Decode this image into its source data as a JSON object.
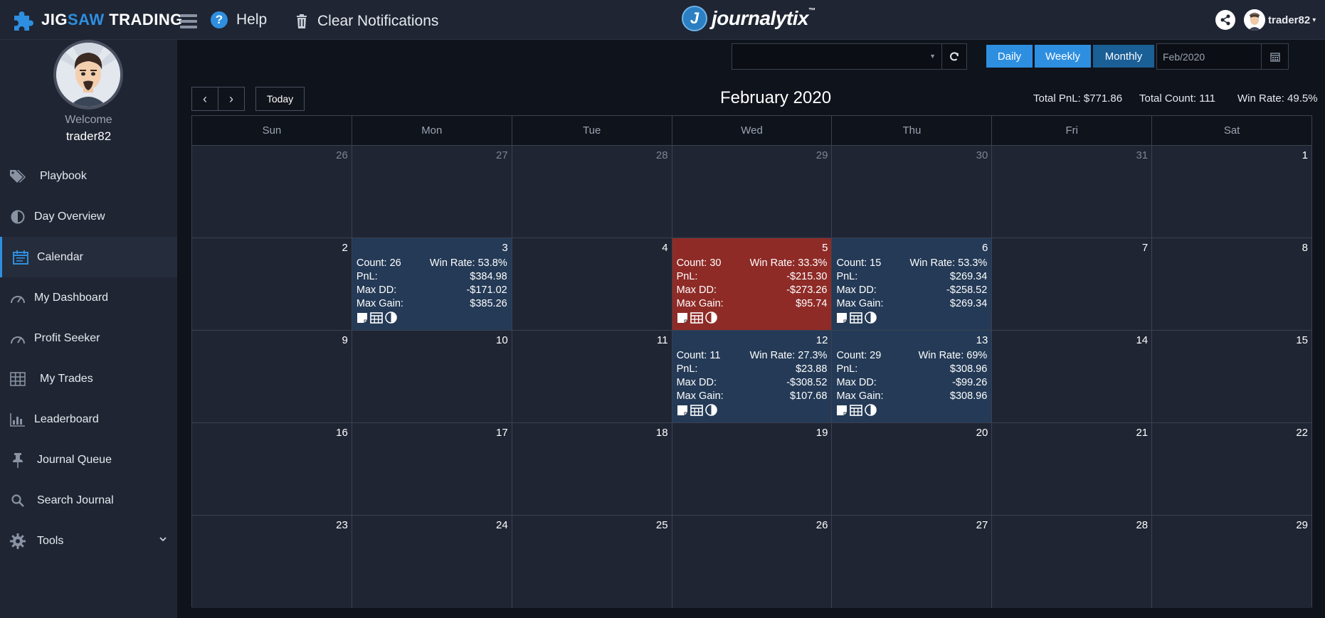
{
  "brand": {
    "part1": "JIG",
    "part2": "SAW",
    "part3": " TRADING"
  },
  "topbar": {
    "help_label": "Help",
    "clear_label": "Clear Notifications",
    "journalytix": "journalytix",
    "tm": "™",
    "username": "trader82"
  },
  "sidebar": {
    "welcome": "Welcome",
    "username": "trader82",
    "items": [
      {
        "label": "Playbook",
        "icon": "tags-icon"
      },
      {
        "label": "Day Overview",
        "icon": "half-circle-icon"
      },
      {
        "label": "Calendar",
        "icon": "calendar-icon",
        "active": true
      },
      {
        "label": "My Dashboard",
        "icon": "speedometer-icon"
      },
      {
        "label": "Profit Seeker",
        "icon": "speedometer-icon"
      },
      {
        "label": "My Trades",
        "icon": "grid-icon"
      },
      {
        "label": "Leaderboard",
        "icon": "bar-chart-icon"
      },
      {
        "label": "Journal Queue",
        "icon": "pin-icon"
      },
      {
        "label": "Search Journal",
        "icon": "search-icon"
      },
      {
        "label": "Tools",
        "icon": "gear-icon"
      }
    ]
  },
  "toolbar": {
    "daily": "Daily",
    "weekly": "Weekly",
    "monthly": "Monthly",
    "month_value": "Feb/2020",
    "today": "Today",
    "prev": "‹",
    "next": "›"
  },
  "calendar": {
    "title": "February 2020",
    "total_pnl": "Total PnL: $771.86",
    "total_count": "Total Count: 111",
    "win_rate": "Win Rate: 49.5%",
    "weekdays": [
      "Sun",
      "Mon",
      "Tue",
      "Wed",
      "Thu",
      "Fri",
      "Sat"
    ],
    "weeks": [
      [
        {
          "day": "26",
          "other": true
        },
        {
          "day": "27",
          "other": true
        },
        {
          "day": "28",
          "other": true
        },
        {
          "day": "29",
          "other": true
        },
        {
          "day": "30",
          "other": true
        },
        {
          "day": "31",
          "other": true
        },
        {
          "day": "1"
        }
      ],
      [
        {
          "day": "2"
        },
        {
          "day": "3",
          "status": "win",
          "count": "Count: 26",
          "winrate": "Win Rate: 53.8%",
          "pnl_label": "PnL:",
          "pnl": "$384.98",
          "dd_label": "Max DD:",
          "dd": "-$171.02",
          "gain_label": "Max Gain:",
          "gain": "$385.26"
        },
        {
          "day": "4"
        },
        {
          "day": "5",
          "status": "loss",
          "count": "Count: 30",
          "winrate": "Win Rate: 33.3%",
          "pnl_label": "PnL:",
          "pnl": "-$215.30",
          "dd_label": "Max DD:",
          "dd": "-$273.26",
          "gain_label": "Max Gain:",
          "gain": "$95.74"
        },
        {
          "day": "6",
          "status": "win",
          "count": "Count: 15",
          "winrate": "Win Rate: 53.3%",
          "pnl_label": "PnL:",
          "pnl": "$269.34",
          "dd_label": "Max DD:",
          "dd": "-$258.52",
          "gain_label": "Max Gain:",
          "gain": "$269.34"
        },
        {
          "day": "7"
        },
        {
          "day": "8"
        }
      ],
      [
        {
          "day": "9"
        },
        {
          "day": "10"
        },
        {
          "day": "11"
        },
        {
          "day": "12",
          "status": "win",
          "count": "Count: 11",
          "winrate": "Win Rate: 27.3%",
          "pnl_label": "PnL:",
          "pnl": "$23.88",
          "dd_label": "Max DD:",
          "dd": "-$308.52",
          "gain_label": "Max Gain:",
          "gain": "$107.68"
        },
        {
          "day": "13",
          "status": "win",
          "count": "Count: 29",
          "winrate": "Win Rate: 69%",
          "pnl_label": "PnL:",
          "pnl": "$308.96",
          "dd_label": "Max DD:",
          "dd": "-$99.26",
          "gain_label": "Max Gain:",
          "gain": "$308.96"
        },
        {
          "day": "14"
        },
        {
          "day": "15"
        }
      ],
      [
        {
          "day": "16"
        },
        {
          "day": "17"
        },
        {
          "day": "18"
        },
        {
          "day": "19"
        },
        {
          "day": "20"
        },
        {
          "day": "21"
        },
        {
          "day": "22"
        }
      ],
      [
        {
          "day": "23"
        },
        {
          "day": "24"
        },
        {
          "day": "25"
        },
        {
          "day": "26"
        },
        {
          "day": "27"
        },
        {
          "day": "28"
        },
        {
          "day": "29"
        }
      ]
    ]
  },
  "colors": {
    "accent": "#2e8fe0",
    "win_day": "#243a56",
    "loss_day": "#8e2b27",
    "panel": "#1f2533",
    "background": "#0f131b"
  }
}
